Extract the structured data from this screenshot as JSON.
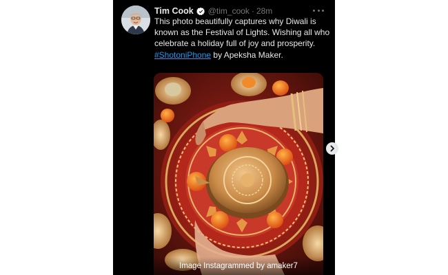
{
  "tweet": {
    "author_name": "Tim Cook",
    "handle": "@tim_cook",
    "separator": "·",
    "time": "28m",
    "text_before": "This photo beautifully captures why Diwali is known as the Festival of Lights. Wishing all who celebrate a holiday full of joy and prosperity. ",
    "hashtag": "#ShotoniPhone",
    "text_after": " by Apeksha Maker.",
    "verified": true,
    "avatar_icon": "person-avatar",
    "media": {
      "caption": "Image Instagrammed by amaker7",
      "alt": "Hands lighting a brass diya on a decorated red plate with marigolds and diyas"
    }
  },
  "controls": {
    "more_icon": "more-horizontal-icon",
    "next_icon": "chevron-right-icon"
  },
  "colors": {
    "background": "#000000",
    "text": "#e7e9ea",
    "muted": "#71767b",
    "link": "#1d9bf0"
  }
}
